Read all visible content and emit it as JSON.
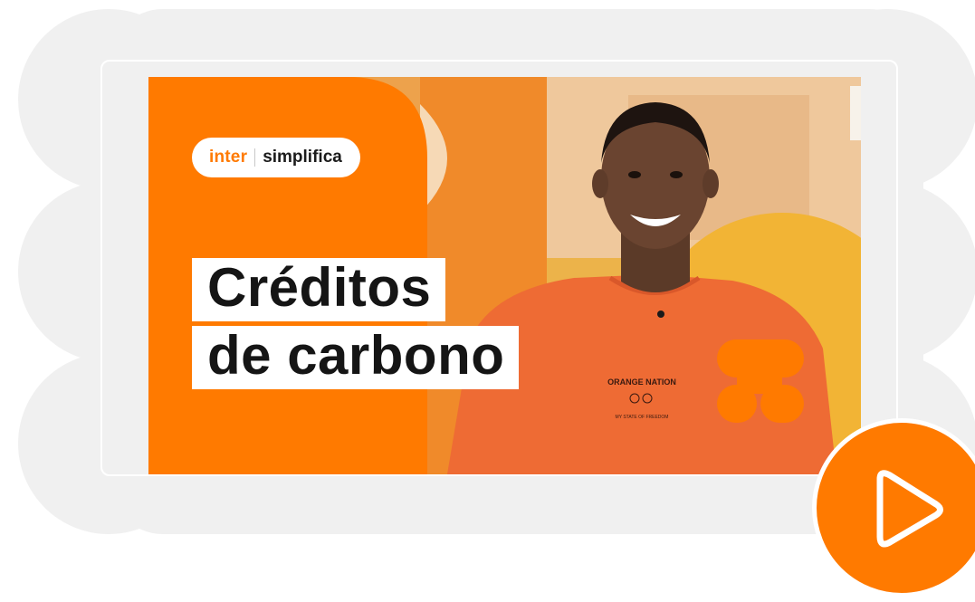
{
  "thumbnail": {
    "brand": {
      "primary": "inter",
      "secondary": "simplifica"
    },
    "title_lines": [
      "Créditos",
      "de carbono"
    ],
    "shirt_text": {
      "line1": "ORANGE NATION",
      "line2": "MY STATE OF FREEDOM"
    }
  },
  "play_button": {
    "icon": "play-icon"
  },
  "colors": {
    "brand_orange": "#ff7a00",
    "backdrop_grey": "#f0f0f0",
    "title_text": "#151515"
  }
}
